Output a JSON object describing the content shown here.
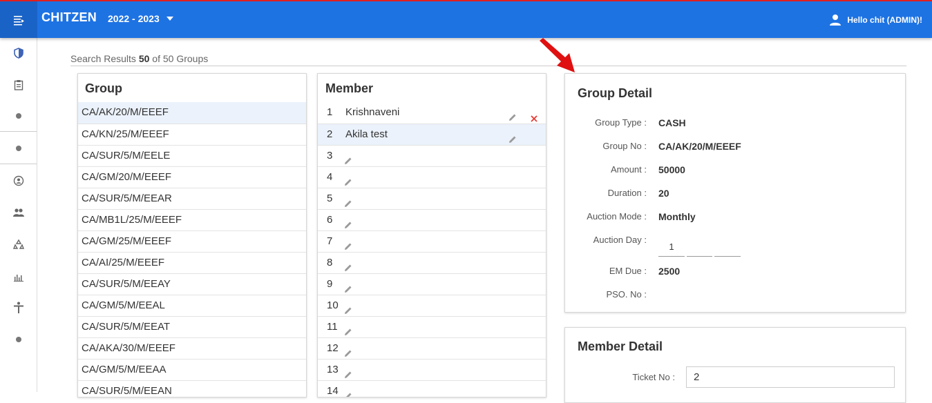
{
  "header": {
    "brand": "CHITZEN",
    "year": "2022 - 2023",
    "user_greeting": "Hello chit (ADMIN)!",
    "menu_icon": "menu-list-icon",
    "user_icon": "person-icon"
  },
  "sidebar": {
    "items": [
      {
        "icon": "shield-icon"
      },
      {
        "icon": "clipboard-icon"
      },
      {
        "icon": "dot-icon"
      },
      {
        "icon": "dot-icon"
      },
      {
        "icon": "account-circle-icon"
      },
      {
        "icon": "people-icon"
      },
      {
        "icon": "recycle-icon"
      },
      {
        "icon": "bar-chart-icon"
      },
      {
        "icon": "accessibility-icon"
      },
      {
        "icon": "dot-icon"
      }
    ]
  },
  "results": {
    "prefix": "Search Results",
    "count": "50",
    "suffix": "of 50 Groups"
  },
  "groups": {
    "title": "Group",
    "items": [
      "CA/AK/20/M/EEEF",
      "CA/KN/25/M/EEEF",
      "CA/SUR/5/M/EELE",
      "CA/GM/20/M/EEEF",
      "CA/SUR/5/M/EEAR",
      "CA/MB1L/25/M/EEEF",
      "CA/GM/25/M/EEEF",
      "CA/AI/25/M/EEEF",
      "CA/SUR/5/M/EEAY",
      "CA/GM/5/M/EEAL",
      "CA/SUR/5/M/EEAT",
      "CA/AKA/30/M/EEEF",
      "CA/GM/5/M/EEAA",
      "CA/SUR/5/M/EEAN"
    ],
    "selected_index": 0
  },
  "members": {
    "title": "Member",
    "items": [
      {
        "num": "1",
        "name": "Krishnaveni"
      },
      {
        "num": "2",
        "name": "Akila test"
      },
      {
        "num": "3",
        "name": ""
      },
      {
        "num": "4",
        "name": ""
      },
      {
        "num": "5",
        "name": ""
      },
      {
        "num": "6",
        "name": ""
      },
      {
        "num": "7",
        "name": ""
      },
      {
        "num": "8",
        "name": ""
      },
      {
        "num": "9",
        "name": ""
      },
      {
        "num": "10",
        "name": ""
      },
      {
        "num": "11",
        "name": ""
      },
      {
        "num": "12",
        "name": ""
      },
      {
        "num": "13",
        "name": ""
      },
      {
        "num": "14",
        "name": ""
      }
    ],
    "selected_index": 1
  },
  "group_detail": {
    "title": "Group Detail",
    "group_type_label": "Group Type :",
    "group_type": "CASH",
    "group_no_label": "Group No :",
    "group_no": "CA/AK/20/M/EEEF",
    "amount_label": "Amount :",
    "amount": "50000",
    "duration_label": "Duration :",
    "duration": "20",
    "auction_mode_label": "Auction Mode :",
    "auction_mode": "Monthly",
    "auction_day_label": "Auction Day :",
    "auction_day": "1",
    "em_due_label": "EM Due :",
    "em_due": "2500",
    "pso_no_label": "PSO. No :",
    "pso_no": ""
  },
  "member_detail": {
    "title": "Member Detail",
    "ticket_no_label": "Ticket No :",
    "ticket_no": "2"
  },
  "colors": {
    "header_bg": "#1e73e3",
    "header_border": "#e01e1e",
    "selected_row": "#ebf2fb",
    "delete_red": "#e53935",
    "annotation_arrow": "#e01010"
  }
}
